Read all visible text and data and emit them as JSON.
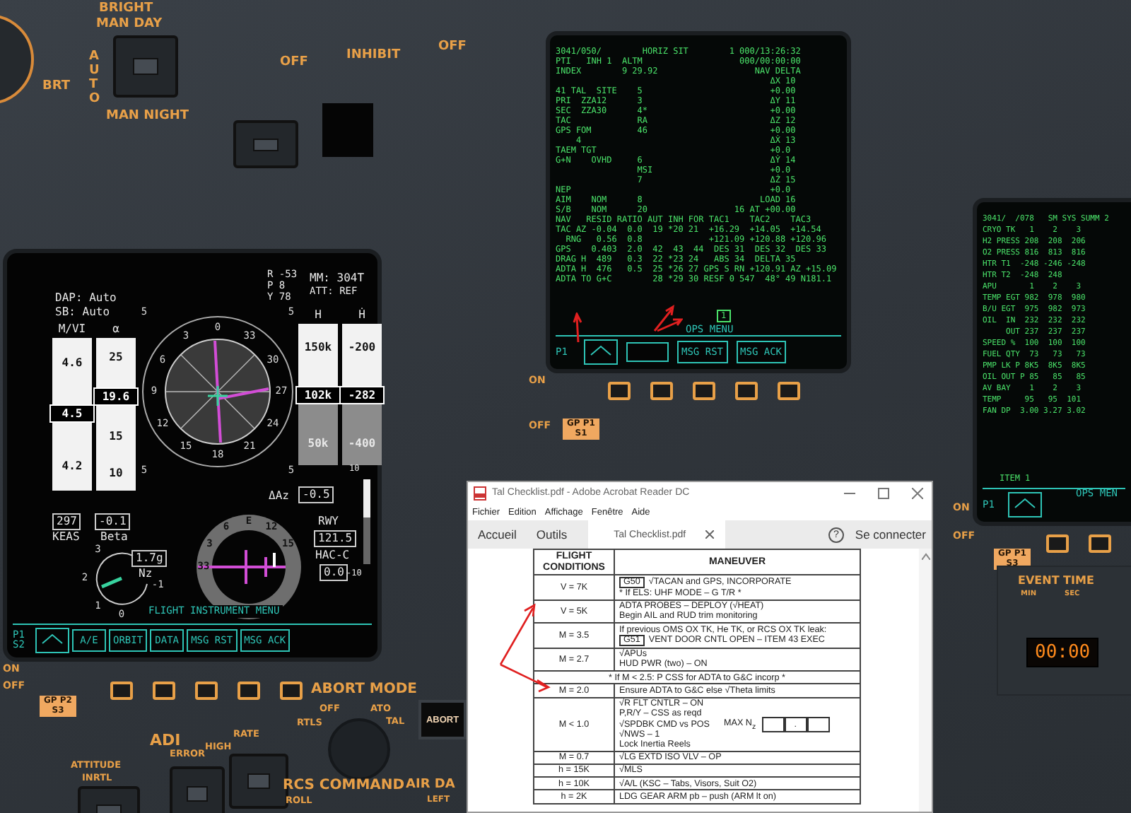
{
  "top_panel": {
    "upper": "BRIGHT",
    "day": "MAN DAY",
    "auto": "AUTO",
    "knob": "BRT",
    "night": "MAN NIGHT",
    "switch_labels": [
      "OFF",
      "INHIBIT",
      "OFF"
    ],
    "switches": [
      {
        "level": 0.5
      },
      {
        "level": 0.5
      }
    ]
  },
  "left_display": {
    "dap": "DAP: Auto",
    "sb": "SB:  Auto",
    "mm": "MM: 304T",
    "att": "ATT: REF",
    "rpy": [
      "R -53",
      "P 8",
      "Y 78"
    ],
    "left_tapes": [
      {
        "label": "M/VI",
        "marks": [
          "4.6",
          "4.2"
        ],
        "current": "4.5"
      },
      {
        "label": "α",
        "marks": [
          "25",
          "15",
          "10"
        ],
        "current": "19.6"
      }
    ],
    "right_tapes": [
      {
        "label": "H",
        "marks": [
          "150k",
          "50k"
        ],
        "current": "102k"
      },
      {
        "label": "Ḣ",
        "marks": [
          "-200",
          "-400"
        ],
        "current": "-282"
      }
    ],
    "adi_labels": [
      "0",
      "33",
      "30",
      "27",
      "24",
      "21",
      "18",
      "15",
      "12",
      "9",
      "6",
      "3"
    ],
    "adi_scale": [
      "5",
      "5",
      "5",
      "5"
    ],
    "delta_az": {
      "label": "ΔAz",
      "value": "-0.5"
    },
    "keas": {
      "value": "297",
      "label": "KEAS"
    },
    "beta": {
      "value": "-0.1",
      "label": "Beta"
    },
    "nz": {
      "value": "1.7g",
      "label": "Nz",
      "scale": [
        "3",
        "2",
        "1",
        "0",
        "-1"
      ]
    },
    "rwy": {
      "label": "RWY",
      "value": "121.5"
    },
    "hac": {
      "label": "HAC-C",
      "value": "0.0"
    },
    "glide_scale": [
      "10",
      "-10"
    ],
    "hsi_labels": [
      "33",
      "3",
      "6",
      "E",
      "12",
      "15"
    ],
    "menu": "FLIGHT INSTRUMENT MENU",
    "port": "P1 S2",
    "softkeys": [
      "A/E",
      "ORBIT",
      "DATA",
      "MSG RST",
      "MSG ACK"
    ],
    "knob_labels": [
      "ON",
      "OFF"
    ],
    "gpc": "GP P2 S3"
  },
  "center_display": {
    "lines": [
      "3041/050/        HORIZ SIT        1 000/13:26:32",
      "PTI   INH 1  ALTM                   000/00:00:00",
      "INDEX        9 29.92                   NAV DELTA",
      "                                          ΔX 10",
      "41 TAL  SITE    5                         +0.00",
      "PRI  ZZA12      3                         ΔY 11",
      "SEC  ZZA30      4*                        +0.00",
      "TAC             RA                        ΔZ 12",
      "GPS FOM         46                        +0.00",
      "    4                                     ΔẊ 13",
      "TAEM TGT                                  +0.0",
      "G+N    OVHD     6                         ΔẎ 14",
      "                MSI                       +0.0",
      "                7                         ΔŻ 15",
      "NEP                                       +0.0",
      "AIM    NOM      8                       LOAD 16",
      "S/B    NOM      20                 16 AT +00.00",
      "NAV   RESID RATIO AUT INH FOR TAC1    TAC2    TAC3",
      "TAC AZ -0.04  0.0  19 *20 21  +16.29  +14.05  +14.54",
      "  RNG   0.56  0.8             +121.09 +120.88 +120.96",
      "GPS    0.403  2.0  42  43  44  DES 31  DES 32  DES 33",
      "DRAG H  489   0.3  22 *23 24   ABS 34  DELTA 35",
      "ADTA H  476   0.5  25 *26 27 GPS S RN +120.91 AZ +15.09",
      "ADTA TO G+C        28 *29 30 RESF 0 547  48° 49 N181.1"
    ],
    "indicator": "1",
    "menu": "OPS MENU",
    "port": "P1",
    "softkeys": [
      "MSG RST",
      "MSG ACK"
    ],
    "knob_labels": [
      "ON",
      "OFF"
    ],
    "gpc": "GP P1 S1"
  },
  "right_display": {
    "lines": [
      "3041/  /078   SM SYS SUMM 2",
      "CRYO TK   1    2    3",
      "H2 PRESS 208  208  206",
      "O2 PRESS 816  813  816",
      "HTR T1  -248 -246 -248",
      "HTR T2  -248  248",
      "APU       1    2    3",
      "TEMP EGT 982  978  980",
      "B/U EGT  975  982  973",
      "OIL  IN  232  232  232",
      "     OUT 237  237  237",
      "SPEED %  100  100  100",
      "FUEL QTY  73   73   73",
      "PMP LK P 8K5  8K5  8K5",
      "OIL OUT P 85   85   85",
      "AV BAY    1    2    3",
      "TEMP     95   95  101",
      "FAN DP  3.00 3.27 3.02"
    ],
    "item": "ITEM 1",
    "menu": "OPS MEN",
    "port": "P1",
    "knob_labels": [
      "ON",
      "OFF"
    ],
    "gpc": "GP P1 S3"
  },
  "event_timer": {
    "title": "EVENT TIME",
    "units": [
      "MIN",
      "SEC"
    ],
    "value": "00:00"
  },
  "bottom_panel": {
    "abort_mode": "ABORT MODE",
    "positions": [
      "RTLS",
      "OFF",
      "ATO",
      "TAL"
    ],
    "abort_button": "ABORT",
    "adi": "ADI",
    "adi_labels": [
      "ERROR",
      "HIGH",
      "RATE"
    ],
    "attitude": "ATTITUDE",
    "inrtl": "INRTL",
    "rcs": "RCS COMMAND",
    "roll": "ROLL",
    "air_data": "AIR DA",
    "left": "LEFT",
    "switches": [
      {
        "level": 0.5
      },
      {
        "level": 0.5
      },
      {
        "level": 0.5
      }
    ]
  },
  "reader": {
    "title": "Tal Checklist.pdf - Adobe Acrobat Reader DC",
    "menu": [
      "Fichier",
      "Edition",
      "Affichage",
      "Fenêtre",
      "Aide"
    ],
    "toolbar": [
      "Accueil",
      "Outils"
    ],
    "tab": "Tal Checklist.pdf",
    "help": "?",
    "sign_in": "Se connecter",
    "columns": [
      "FLIGHT CONDITIONS",
      "MANEUVER"
    ],
    "rows": [
      {
        "kind": "step",
        "condition": "V = 7K",
        "lines": [
          {
            "tag": "G50",
            "text": "√TACAN and GPS, INCORPORATE"
          },
          {
            "text": "* If ELS:  UHF MODE – G T/R *"
          }
        ]
      },
      {
        "kind": "step",
        "condition": "V = 5K",
        "lines": [
          {
            "text": "ADTA PROBES – DEPLOY (√HEAT)"
          },
          {
            "text": "Begin AIL and RUD trim monitoring"
          }
        ]
      },
      {
        "kind": "step",
        "condition": "M = 3.5",
        "lines": [
          {
            "text": "If previous OMS OX TK, He TK, or RCS OX TK leak:"
          },
          {
            "tag": "G51",
            "text": "VENT DOOR CNTL OPEN – ITEM 43 EXEC"
          }
        ]
      },
      {
        "kind": "step",
        "condition": "M = 2.7",
        "lines": [
          {
            "text": "√APUs"
          },
          {
            "text": "HUD PWR (two) – ON"
          }
        ]
      },
      {
        "kind": "note",
        "lines": [
          {
            "text": "*  If M < 2.5: P CSS for ADTA to G&C incorp  *"
          }
        ]
      },
      {
        "kind": "step",
        "condition": "M = 2.0",
        "lines": [
          {
            "text": "Ensure ADTA to G&C else √Theta limits"
          }
        ]
      },
      {
        "kind": "step",
        "condition": "M < 1.0",
        "lines": [
          {
            "text": "√R FLT CNTLR – ON"
          },
          {
            "text": "P,R/Y – CSS as reqd"
          },
          {
            "text": "√SPDBK CMD vs POS"
          },
          {
            "text": "√NWS – 1"
          },
          {
            "text": "Lock Inertia Reels"
          }
        ],
        "entry": {
          "label": "MAX N$_{z}$",
          "separator": "."
        }
      },
      {
        "kind": "step",
        "condition": "M = 0.7",
        "lines": [
          {
            "text": "√LG EXTD ISO VLV – OP"
          }
        ]
      },
      {
        "kind": "step",
        "condition": "h = 15K",
        "lines": [
          {
            "text": "√MLS"
          }
        ]
      },
      {
        "kind": "step",
        "condition": "h = 10K",
        "lines": [
          {
            "text": "√A/L (KSC – Tabs, Visors, Suit O2)"
          }
        ]
      },
      {
        "kind": "step",
        "condition": "h = 2K",
        "lines": [
          {
            "text": "LDG GEAR ARM pb – push (ARM lt on)"
          }
        ]
      }
    ]
  }
}
